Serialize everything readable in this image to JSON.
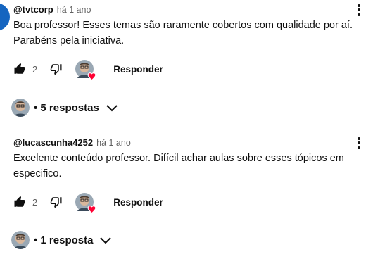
{
  "comments": [
    {
      "author": "@tvtcorp",
      "time": "há 1 ano",
      "text": "Boa professor! Esses temas são raramente cobertos com qualidade por aí. Parabéns pela iniciativa.",
      "likes": "2",
      "reply_label": "Responder",
      "replies_label": "• 5 respostas"
    },
    {
      "author": "@lucascunha4252",
      "time": "há 1 ano",
      "text": "Excelente conteúdo professor. Difícil achar aulas sobre esses tópicos em especifico.",
      "likes": "2",
      "reply_label": "Responder",
      "replies_label": "• 1 resposta"
    }
  ],
  "colors": {
    "heart": "#ff0033",
    "edge_avatar": "#1565c0"
  },
  "icons": [
    "thumb-up-icon",
    "thumb-down-icon",
    "kebab-menu-icon",
    "chevron-down-icon",
    "heart-icon"
  ]
}
